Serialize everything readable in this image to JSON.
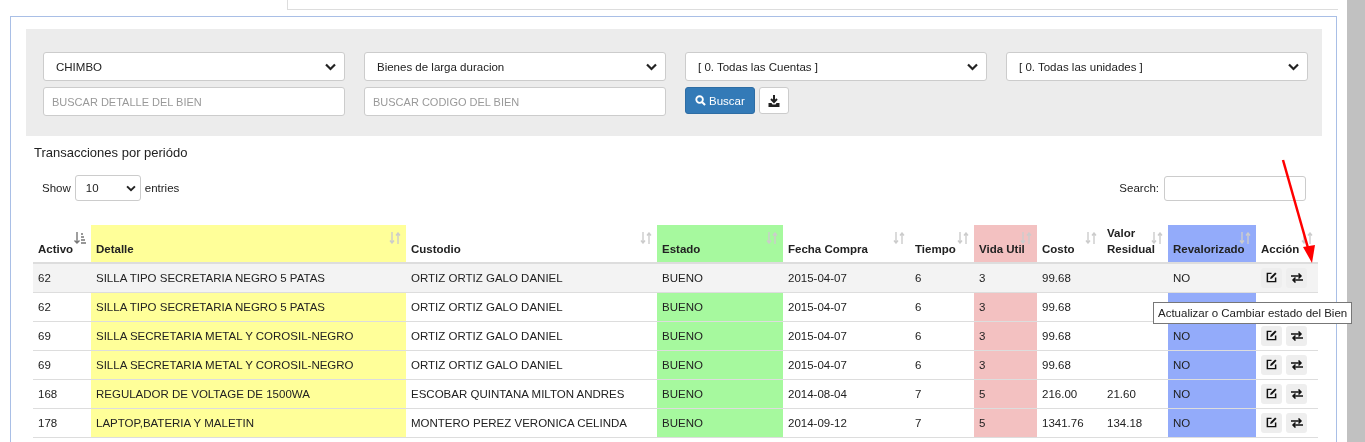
{
  "filters": {
    "selects": [
      {
        "value": "CHIMBO"
      },
      {
        "value": "Bienes de larga duracion"
      },
      {
        "value": "[ 0. Todas las Cuentas ]"
      },
      {
        "value": "[ 0. Todas las unidades ]"
      }
    ],
    "fields": [
      {
        "placeholder": "BUSCAR DETALLE DEL BIEN"
      },
      {
        "placeholder": "BUSCAR CODIGO DEL BIEN"
      }
    ],
    "search_button": "Buscar"
  },
  "section_title": "Transacciones por periódo",
  "length": {
    "show": "Show",
    "value": "10",
    "entries": "entries"
  },
  "search": {
    "label": "Search:"
  },
  "table": {
    "columns": [
      {
        "label": "Activo",
        "sorted": true
      },
      {
        "label": "Detalle",
        "sorted": false,
        "color": "#ffff99"
      },
      {
        "label": "Custodio",
        "sorted": false
      },
      {
        "label": "Estado",
        "sorted": false,
        "color": "#a6f99e"
      },
      {
        "label": "Fecha Compra",
        "sorted": false
      },
      {
        "label": "Tiempo",
        "sorted": false
      },
      {
        "label": "Vida Util",
        "sorted": false,
        "color": "#f3c1c1"
      },
      {
        "label": "Costo",
        "sorted": false
      },
      {
        "label": "Valor Residual",
        "sorted": false
      },
      {
        "label": "Revalorizado",
        "sorted": false,
        "color": "#93abfa"
      },
      {
        "label": "Acción",
        "sorted": false
      }
    ],
    "rows": [
      {
        "hovered": true,
        "actions": true,
        "cells": [
          "62",
          "SILLA TIPO SECRETARIA NEGRO 5 PATAS",
          "ORTIZ ORTIZ GALO DANIEL",
          "BUENO",
          "2015-04-07",
          "6",
          "3",
          "99.68",
          "",
          "NO"
        ]
      },
      {
        "hovered": false,
        "actions": false,
        "cells": [
          "62",
          "SILLA TIPO SECRETARIA NEGRO 5 PATAS",
          "ORTIZ ORTIZ GALO DANIEL",
          "BUENO",
          "2015-04-07",
          "6",
          "3",
          "99.68",
          "",
          ""
        ]
      },
      {
        "hovered": false,
        "actions": true,
        "cells": [
          "69",
          "SILLA SECRETARIA METAL Y COROSIL-NEGRO",
          "ORTIZ ORTIZ GALO DANIEL",
          "BUENO",
          "2015-04-07",
          "6",
          "3",
          "99.68",
          "",
          "NO"
        ]
      },
      {
        "hovered": false,
        "actions": true,
        "cells": [
          "69",
          "SILLA SECRETARIA METAL Y COROSIL-NEGRO",
          "ORTIZ ORTIZ GALO DANIEL",
          "BUENO",
          "2015-04-07",
          "6",
          "3",
          "99.68",
          "",
          "NO"
        ]
      },
      {
        "hovered": false,
        "actions": true,
        "cells": [
          "168",
          "REGULADOR DE VOLTAGE DE 1500WA",
          "ESCOBAR QUINTANA MILTON ANDRES",
          "BUENO",
          "2014-08-04",
          "7",
          "5",
          "216.00",
          "21.60",
          "NO"
        ]
      },
      {
        "hovered": false,
        "actions": true,
        "cells": [
          "178",
          "LAPTOP,BATERIA Y MALETIN",
          "MONTERO PEREZ VERONICA CELINDA",
          "BUENO",
          "2014-09-12",
          "7",
          "5",
          "1341.76",
          "134.18",
          "NO"
        ]
      }
    ]
  },
  "tooltip": "Actualizar o Cambiar estado del Bien"
}
